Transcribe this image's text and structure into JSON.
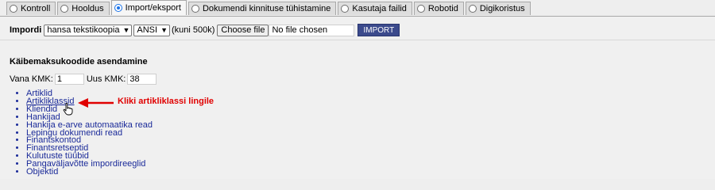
{
  "tabs": [
    {
      "label": "Kontroll",
      "checked": false
    },
    {
      "label": "Hooldus",
      "checked": false
    },
    {
      "label": "Import/eksport",
      "checked": true
    },
    {
      "label": "Dokumendi kinnituse tühistamine",
      "checked": false
    },
    {
      "label": "Kasutaja failid",
      "checked": false
    },
    {
      "label": "Robotid",
      "checked": false
    },
    {
      "label": "Digikoristus",
      "checked": false
    }
  ],
  "import_row": {
    "label": "Impordi",
    "source_select": "hansa tekstikoopia",
    "encoding_select": "ANSI",
    "size_hint": "(kuni 500k)",
    "choose_file_label": "Choose file",
    "file_status": "No file chosen",
    "import_button": "IMPORT"
  },
  "kmk": {
    "section_title": "Käibemaksukoodide asendamine",
    "old_label": "Vana KMK:",
    "old_value": "1",
    "new_label": "Uus KMK:",
    "new_value": "38"
  },
  "links": [
    "Artiklid",
    "Artikliklassid",
    "Kliendid",
    "Hankijad",
    "Hankija e-arve automaatika read",
    "Lepingu dokumendi read",
    "Finantskontod",
    "Finantsretseptid",
    "Kulutuste tüübid",
    "Pangaväljavõtte impordireeglid",
    "Objektid"
  ],
  "annotation": "Kliki artikliklassi lingile",
  "colors": {
    "link": "#1a2a99",
    "annotation": "#e00000",
    "import_button_bg": "#3b4a8c"
  }
}
